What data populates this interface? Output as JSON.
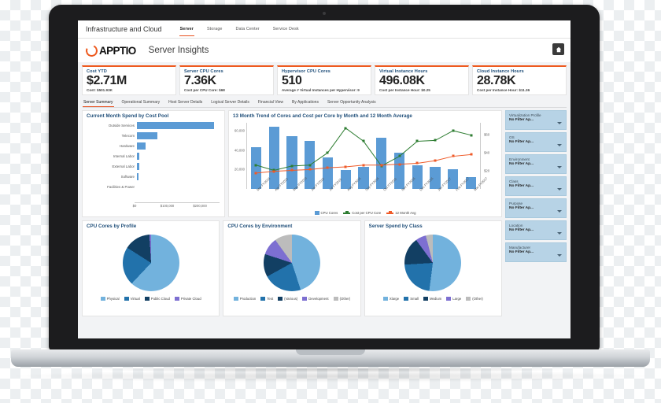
{
  "window": {
    "app_title": "Infrastructure and Cloud",
    "top_nav": [
      {
        "label": "Server",
        "active": true
      },
      {
        "label": "Storage",
        "active": false
      },
      {
        "label": "Data Center",
        "active": false
      },
      {
        "label": "Service Desk",
        "active": false
      }
    ],
    "brand": "APPTIO",
    "page_title": "Server Insights",
    "home_button_icon": "home-icon"
  },
  "kpis": [
    {
      "label": "Cost YTD",
      "value": "$2.71M",
      "sub": "Cost: $501.93K"
    },
    {
      "label": "Server CPU Cores",
      "value": "7.36K",
      "sub": "Cost per CPU Core: $68"
    },
    {
      "label": "Hypervisor CPU Cores",
      "value": "510",
      "sub": "Average # Virtual Instances per Hypervisor: 9"
    },
    {
      "label": "Virtual Instance Hours",
      "value": "496.08K",
      "sub": "Cost per Instance Hour: $0.25"
    },
    {
      "label": "Cloud Instance Hours",
      "value": "28.78K",
      "sub": "Cost per Instance Hour: $11.36"
    }
  ],
  "tabs": [
    {
      "label": "Server Summary",
      "active": true
    },
    {
      "label": "Operational Summary",
      "active": false
    },
    {
      "label": "Host Server Details",
      "active": false
    },
    {
      "label": "Logical Server Details",
      "active": false
    },
    {
      "label": "Financial View",
      "active": false
    },
    {
      "label": "By Applications",
      "active": false
    },
    {
      "label": "Server Opportunity Analysis",
      "active": false
    }
  ],
  "filters": [
    {
      "label": "Virtualization Profile",
      "value": "No Filter Ap..."
    },
    {
      "label": "OS",
      "value": "No Filter Ap..."
    },
    {
      "label": "Environment",
      "value": "No Filter Ap..."
    },
    {
      "label": "Class",
      "value": "No Filter Ap..."
    },
    {
      "label": "Purpose",
      "value": "No Filter Ap..."
    },
    {
      "label": "Location",
      "value": "No Filter Ap..."
    },
    {
      "label": "Manufacturer",
      "value": "No Filter Ap..."
    }
  ],
  "colors": {
    "accent_orange": "#ee5a1f",
    "bar_blue": "#5b9bd5",
    "line_green": "#2e7d32",
    "line_orange": "#ef5a28",
    "pie_light": "#72b2dd",
    "pie_mid": "#2272ab",
    "pie_dark": "#123f63",
    "pie_purple": "#7d6fd1",
    "pie_gray": "#bcbcbc",
    "filter_bg": "#b7d3e6",
    "title_blue": "#1f4e79"
  },
  "chart_data": [
    {
      "type": "bar",
      "orientation": "horizontal",
      "title": "Current Month Spend by Cost Pool",
      "categories": [
        "Outside Services",
        "Telecom",
        "Hardware",
        "Internal Labor",
        "External Labor",
        "Software",
        "Facilities & Power"
      ],
      "values": [
        243000,
        65000,
        27000,
        8000,
        8000,
        6000,
        0
      ],
      "xlabel": "",
      "ylabel": "",
      "xlim": [
        0,
        260000
      ],
      "xtick_labels": [
        "$0",
        "$100,000",
        "$200,000"
      ],
      "xtick_values": [
        0,
        100000,
        200000
      ],
      "grid": false,
      "series_color": "#5b9bd5"
    },
    {
      "type": "bar",
      "title": "13 Month Trend of Cores and Cost per Core by Month and 12 Month Average",
      "categories": [
        "Mar FY2016",
        "Apr FY2016",
        "May FY2016",
        "Jun FY2016",
        "Jul FY2016",
        "Aug FY2016",
        "Sep FY2016",
        "Oct FY2016",
        "Nov FY2016",
        "Dec FY2016",
        "Jan FY2017",
        "Feb FY2017",
        "Mar FY2017"
      ],
      "series": [
        {
          "name": "CPU Cores",
          "type": "bar",
          "axis": "left",
          "color": "#5b9bd5",
          "values": [
            44000,
            66000,
            55500,
            50500,
            33000,
            20000,
            23500,
            54000,
            38000,
            25000,
            23000,
            20500,
            12500
          ]
        },
        {
          "name": "Cost per CPU Core",
          "type": "line",
          "axis": "right",
          "color": "#2e7d32",
          "values": [
            27,
            21,
            26,
            27,
            41,
            69,
            54,
            26,
            37,
            54,
            55,
            66,
            61
          ]
        },
        {
          "name": "12 Month Avg",
          "type": "line",
          "axis": "right",
          "color": "#ef5a28",
          "values": [
            18,
            20,
            21,
            22,
            24,
            25,
            27,
            27,
            28,
            29,
            32,
            37,
            39
          ]
        }
      ],
      "ylabel": "",
      "ylim": [
        0,
        70000
      ],
      "ytick_labels": [
        "20,000",
        "40,000",
        "60,000"
      ],
      "ytick_values": [
        20000,
        40000,
        60000
      ],
      "y2_labels": [
        "$20",
        "$40",
        "$60"
      ],
      "y2_values": [
        20,
        40,
        60
      ],
      "y2lim": [
        0,
        75
      ],
      "legend": [
        "CPU Cores",
        "Cost per CPU Core",
        "12 Month Avg"
      ],
      "legend_position": "bottom",
      "grid": false
    },
    {
      "type": "pie",
      "title": "CPU Cores by Profile",
      "labels": [
        "Physical",
        "Virtual",
        "Public Cloud",
        "Private Cloud"
      ],
      "values": [
        62,
        22,
        15,
        1
      ],
      "colors": [
        "#72b2dd",
        "#2272ab",
        "#123f63",
        "#7d6fd1"
      ],
      "legend_position": "bottom"
    },
    {
      "type": "pie",
      "title": "CPU Cores by Environment",
      "labels": [
        "Production",
        "Test",
        "(Various)",
        "Development",
        "(Other)"
      ],
      "values": [
        45,
        22,
        13,
        10,
        10
      ],
      "colors": [
        "#72b2dd",
        "#2272ab",
        "#123f63",
        "#7d6fd1",
        "#bcbcbc"
      ],
      "legend_position": "bottom"
    },
    {
      "type": "pie",
      "title": "Server Spend by Class",
      "labels": [
        "Xlarge",
        "Small",
        "Medium",
        "Large",
        "(Other)"
      ],
      "values": [
        52,
        22,
        16,
        6,
        4
      ],
      "colors": [
        "#72b2dd",
        "#2272ab",
        "#123f63",
        "#7d6fd1",
        "#bcbcbc"
      ],
      "legend_position": "bottom"
    }
  ]
}
